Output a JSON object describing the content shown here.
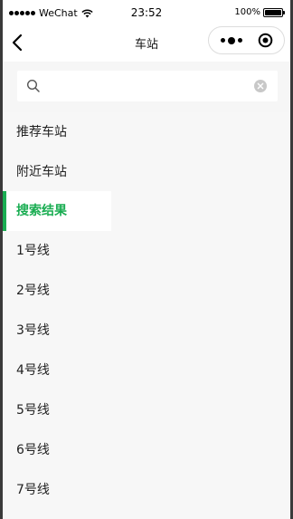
{
  "status_bar": {
    "carrier": "WeChat",
    "time": "23:52",
    "battery_text": "100%",
    "battery_level": 1.0
  },
  "nav": {
    "title": "车站",
    "back_icon": "chevron-left-icon",
    "more_icon": "more-dots-icon",
    "close_icon": "target-icon"
  },
  "search": {
    "value": "",
    "placeholder": "",
    "search_icon": "search-icon",
    "clear_icon": "clear-circle-icon"
  },
  "sidebar": {
    "items": [
      {
        "label": "推荐车站",
        "active": false
      },
      {
        "label": "附近车站",
        "active": false
      },
      {
        "label": "搜索结果",
        "active": true
      },
      {
        "label": "1号线",
        "active": false
      },
      {
        "label": "2号线",
        "active": false
      },
      {
        "label": "3号线",
        "active": false
      },
      {
        "label": "4号线",
        "active": false
      },
      {
        "label": "5号线",
        "active": false
      },
      {
        "label": "6号线",
        "active": false
      },
      {
        "label": "7号线",
        "active": false
      }
    ]
  },
  "colors": {
    "accent": "#1aad52",
    "sidebar_bg": "#f7f7f7",
    "search_bg": "#f6f6f6",
    "frame": "#3a3a3a"
  }
}
